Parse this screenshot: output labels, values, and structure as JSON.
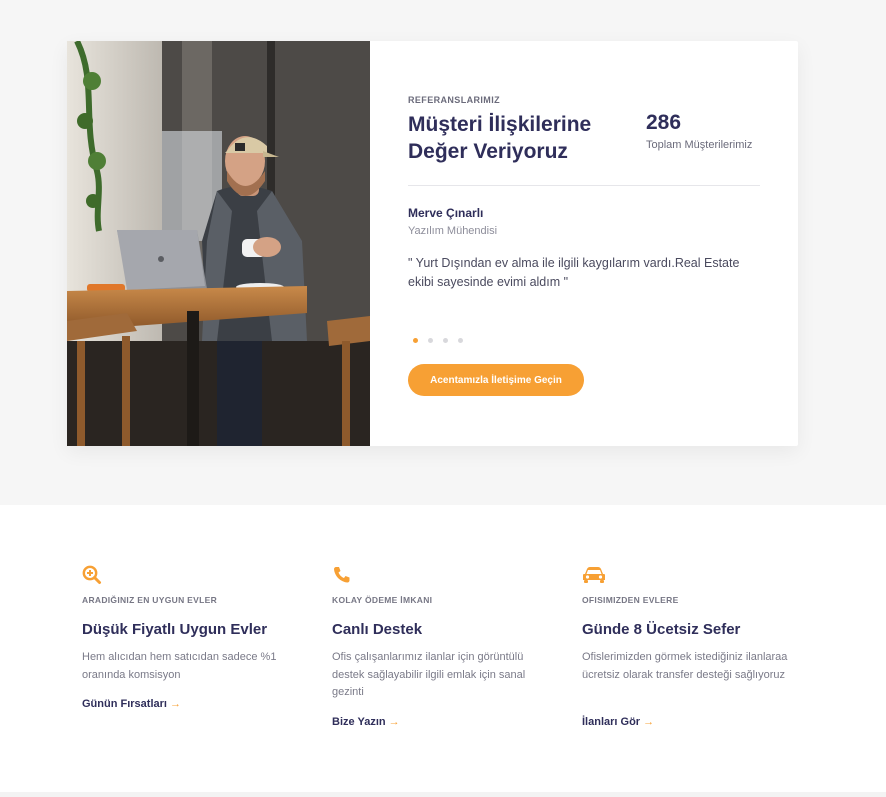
{
  "testimonial": {
    "eyebrow": "REFERANSLARIMIZ",
    "title": "Müşteri İlişkilerine Değer Veriyoruz",
    "stat_value": "286",
    "stat_label": "Toplam Müşterilerimiz",
    "person_name": "Merve Çınarlı",
    "person_role": "Yazılım Mühendisi",
    "quote": "\" Yurt Dışından ev alma ile ilgili kaygılarım vardı.Real Estate ekibi sayesinde evimi aldım \"",
    "slide_count": 4,
    "active_slide": 1,
    "cta_label": "Acentamızla İletişime Geçin"
  },
  "features": [
    {
      "icon": "search-plus-icon",
      "eyebrow": "ARADIĞINIZ EN UYGUN EVLER",
      "title": "Düşük Fiyatlı Uygun Evler",
      "description": "Hem alıcıdan hem satıcıdan sadece %1 oranında komsisyon",
      "link_label": "Günün Fırsatları",
      "link_arrow": "→"
    },
    {
      "icon": "phone-icon",
      "eyebrow": "KOLAY ÖDEME İMKANI",
      "title": "Canlı Destek",
      "description": "Ofis çalışanlarımız ilanlar için görüntülü destek sağlayabilir ilgili emlak için sanal gezinti",
      "link_label": "Bize Yazın",
      "link_arrow": "→"
    },
    {
      "icon": "car-icon",
      "eyebrow": "OFISIMIZDEN EVLERE",
      "title": "Günde 8 Ücetsiz Sefer",
      "description": "Ofislerimizden görmek istediğiniz ilanlaraa ücretsiz olarak transfer desteği sağlıyoruz",
      "link_label": "İlanları Gör",
      "link_arrow": "→"
    }
  ],
  "colors": {
    "accent": "#f7a034",
    "heading": "#2f2e5a",
    "section_bg": "#f6f6f6"
  }
}
